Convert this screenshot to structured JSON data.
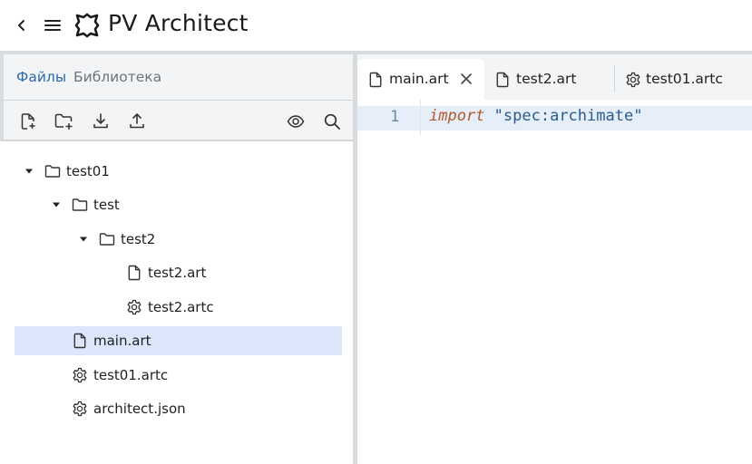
{
  "app": {
    "title": "PV Architect"
  },
  "left_panel": {
    "tabs": [
      {
        "label": "Файлы",
        "active": true
      },
      {
        "label": "Библиотека",
        "active": false
      }
    ],
    "toolbar": [
      "new-file-icon",
      "new-folder-icon",
      "download-icon",
      "upload-icon",
      "eye-icon",
      "search-icon"
    ]
  },
  "tree": [
    {
      "label": "test01",
      "type": "folder",
      "expanded": true,
      "depth": 0
    },
    {
      "label": "test",
      "type": "folder",
      "expanded": true,
      "depth": 1
    },
    {
      "label": "test2",
      "type": "folder",
      "expanded": true,
      "depth": 2
    },
    {
      "label": "test2.art",
      "type": "file",
      "depth": 3
    },
    {
      "label": "test2.artc",
      "type": "config",
      "depth": 3
    },
    {
      "label": "main.art",
      "type": "file",
      "depth": 1,
      "selected": true
    },
    {
      "label": "test01.artc",
      "type": "config",
      "depth": 1
    },
    {
      "label": "architect.json",
      "type": "config",
      "depth": 1
    }
  ],
  "editor": {
    "tabs": [
      {
        "label": "main.art",
        "icon": "file-icon",
        "active": true,
        "closable": true
      },
      {
        "label": "test2.art",
        "icon": "file-icon",
        "active": false
      },
      {
        "label": "test01.artc",
        "icon": "gear-icon",
        "active": false
      }
    ],
    "lines": [
      {
        "number": "1",
        "keyword": "import",
        "string": "\"spec:archimate\""
      }
    ]
  },
  "colors": {
    "accent": "#2d6aa8",
    "selection": "#dbe6fb",
    "keyword": "#b05a2f",
    "string": "#2a5b8a"
  }
}
